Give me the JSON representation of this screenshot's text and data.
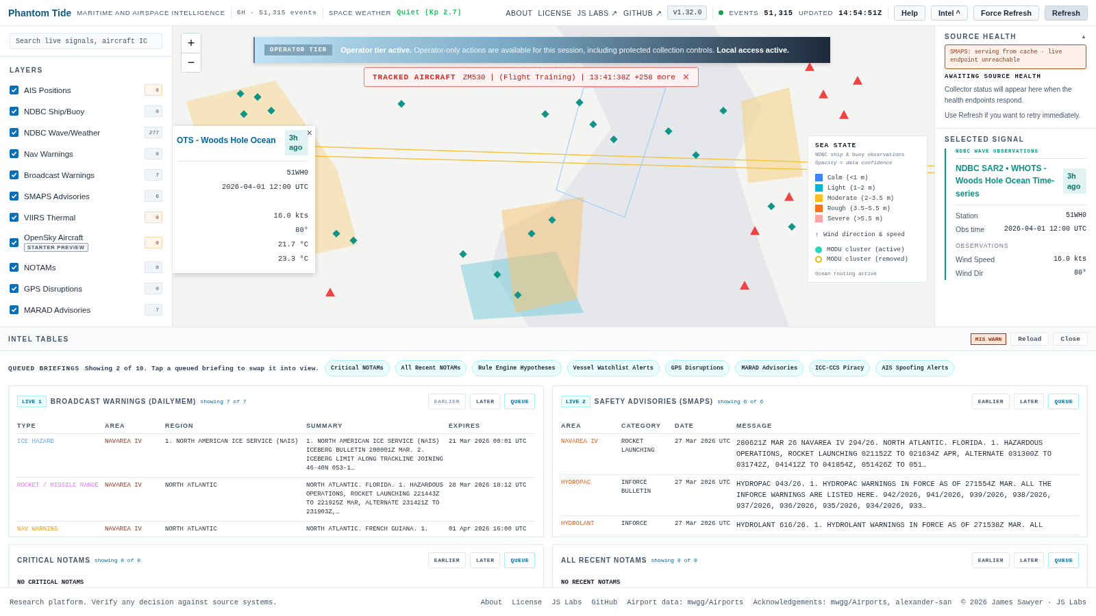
{
  "header": {
    "brand": "Phantom Tide",
    "tagline": "MARITIME AND AIRSPACE INTELLIGENCE",
    "window": "6H · 51,315 events",
    "space_weather_label": "SPACE WEATHER",
    "space_weather_value": "Quiet (Kp 2.7)",
    "nav": [
      "ABOUT",
      "LICENSE",
      "JS LABS ↗",
      "GITHUB ↗"
    ],
    "version": "v1.32.0",
    "online": true,
    "events_label": "EVENTS",
    "events_value": "51,315",
    "updated_label": "UPDATED",
    "updated_value": "14:54:51Z",
    "buttons": [
      {
        "label": "Help",
        "kind": "plain"
      },
      {
        "label": "Intel ^",
        "kind": "plain"
      },
      {
        "label": "Force Refresh",
        "kind": "plain"
      },
      {
        "label": "Refresh",
        "kind": "primary"
      }
    ]
  },
  "sidebar": {
    "search": {
      "placeholder": "Search live signals, aircraft IC"
    },
    "layers_title": "LAYERS",
    "layers": [
      {
        "label": "AIS Positions",
        "checked": true,
        "count": "0",
        "highlighted": true
      },
      {
        "label": "NDBC Ship/Buoy",
        "checked": true,
        "count": "0",
        "highlighted": false
      },
      {
        "label": "NDBC Wave/Weather",
        "checked": true,
        "count": "277",
        "highlighted": false
      },
      {
        "label": "Nav Warnings",
        "checked": true,
        "count": "0",
        "highlighted": false
      },
      {
        "label": "Broadcast Warnings",
        "checked": true,
        "count": "7",
        "highlighted": false
      },
      {
        "label": "SMAPS Advisories",
        "checked": true,
        "count": "6",
        "highlighted": false
      },
      {
        "label": "VIIRS Thermal",
        "checked": true,
        "count": "0",
        "highlighted": true
      },
      {
        "label": "OpenSky Aircraft",
        "badge": "STARTER PREVIEW",
        "checked": true,
        "count": "0",
        "highlighted": true
      },
      {
        "label": "NOTAMs",
        "checked": true,
        "count": "0",
        "highlighted": false
      },
      {
        "label": "GPS Disruptions",
        "checked": true,
        "count": "0",
        "highlighted": false
      },
      {
        "label": "MARAD Advisories",
        "checked": true,
        "count": "7",
        "highlighted": false
      }
    ]
  },
  "map": {
    "zoom_in": "+",
    "zoom_out": "−",
    "banner": {
      "tag": "OPERATOR TIER",
      "text": "**Operator tier active.** Operator-only actions are available for this session, including protected collection controls. **Local access active.**"
    },
    "alert": {
      "label": "TRACKED AIRCRAFT",
      "text": "ZM530 | (Flight Training) | 13:41:38Z +258 more",
      "close": "✕"
    },
    "popup": {
      "title": "OTS - Woods Hole Ocean",
      "age": "3h ago",
      "close": "×",
      "values": [
        "51WH0",
        "2026-04-01 12:00 UTC",
        "16.0 kts",
        "80°",
        "21.7 °C",
        "23.3 °C"
      ]
    },
    "legend": {
      "title": "SEA STATE",
      "subtitle": "NDBC ship & buoy observations",
      "note": "Opacity = data confidence",
      "items": [
        {
          "label": "Calm (<1 m)",
          "color": "#3b82f6"
        },
        {
          "label": "Light (1–2 m)",
          "color": "#06b6d4"
        },
        {
          "label": "Moderate (2–3.5 m)",
          "color": "#fbbf24"
        },
        {
          "label": "Rough (3.5–5.5 m)",
          "color": "#f97316"
        },
        {
          "label": "Severe (>5.5 m)",
          "color": "#fca5a5"
        }
      ],
      "extras": [
        {
          "kind": "arrow",
          "symbol": "↑",
          "label": "Wind direction & speed"
        },
        {
          "kind": "filled",
          "label": "MODU cluster (active)"
        },
        {
          "kind": "ring",
          "label": "MODU cluster (removed)"
        }
      ],
      "footer": "Ocean routing active"
    }
  },
  "right_panel": {
    "source_health": {
      "title": "SOURCE HEALTH",
      "toggle": "▲",
      "expanded": true,
      "warning": "SMAPS: serving from cache · live endpoint unreachable",
      "status_title": "AWAITING SOURCE HEALTH",
      "paragraphs": [
        "Collector status will appear here when the health endpoints respond.",
        "Use Refresh if you want to retry immediately."
      ]
    },
    "selected_signal": {
      "title": "SELECTED SIGNAL",
      "tag": "NDBC WAVE OBSERVATIONS",
      "name": "NDBC SAR2 • WHOTS - Woods Hole Ocean Time-series",
      "age": "3h ago",
      "rows": [
        {
          "label": "Station",
          "value": "51WH0"
        },
        {
          "label": "Obs time",
          "value": "2026-04-01 12:00 UTC"
        }
      ],
      "section": "OBSERVATIONS",
      "observations": [
        {
          "label": "Wind Speed",
          "value": "16.0 kts"
        },
        {
          "label": "Wind Dir",
          "value": "80°"
        }
      ]
    }
  },
  "intel": {
    "title": "INTEL TABLES",
    "badge": "MIS WARN",
    "buttons": [
      "Reload",
      "Close"
    ],
    "queue": {
      "label": "QUEUED BRIEFINGS",
      "text": "Showing 2 of 10. Tap a queued briefing to swap it into view.",
      "chips": [
        "Critical NOTAMs",
        "All Recent NOTAMs",
        "Rule Engine Hypotheses",
        "Vessel Watchlist Alerts",
        "GPS Disruptions",
        "MARAD Advisories",
        "ICC-CCS Piracy",
        "AIS Spoofing Alerts"
      ]
    },
    "panels": [
      {
        "live": "LIVE 1",
        "title": "BROADCAST WARNINGS (DAILYMEM)",
        "showing": "showing 7 of 7",
        "controls": [
          {
            "label": "EARLIER",
            "disabled": true,
            "kind": "nav"
          },
          {
            "label": "LATER",
            "disabled": false,
            "kind": "nav"
          },
          {
            "label": "QUEUE",
            "disabled": false,
            "kind": "queue"
          }
        ],
        "columns": [
          "TYPE",
          "AREA",
          "REGION",
          "SUMMARY",
          "EXPIRES"
        ],
        "kind": "warnings",
        "rows": [
          {
            "cells": [
              "ICE HAZARD",
              "NAVAREA IV",
              "1. NORTH AMERICAN ICE SERVICE (NAIS)",
              "1. NORTH AMERICAN ICE SERVICE (NAIS) ICEBERG BULLETIN 200001Z MAR. 2. ICEBERG LIMIT ALONG TRACKLINE JOINING 46-40N 053-1…",
              "21 Mar 2026 00:01 UTC"
            ],
            "kind": "ice"
          },
          {
            "cells": [
              "ROCKET / MISSILE RANGE",
              "NAVAREA IV",
              "NORTH ATLANTIC",
              "NORTH ATLANTIC. FLORIDA. 1. HAZARDOUS OPERATIONS, ROCKET LAUNCHING 221443Z TO 221925Z MAR, ALTERNATE 231421Z TO 231903Z,…",
              "28 Mar 2026 18:12 UTC"
            ],
            "kind": "range"
          },
          {
            "cells": [
              "NAV WARNING",
              "NAVAREA IV",
              "NORTH ATLANTIC",
              "NORTH ATLANTIC. FRENCH GUIANA. 1.",
              "01 Apr 2026 16:00 UTC"
            ],
            "kind": "nav"
          }
        ]
      },
      {
        "live": "LIVE 2",
        "title": "SAFETY ADVISORIES (SMAPS)",
        "showing": "showing 6 of 6",
        "controls": [
          {
            "label": "EARLIER",
            "disabled": false,
            "kind": "nav"
          },
          {
            "label": "LATER",
            "disabled": false,
            "kind": "nav"
          },
          {
            "label": "QUEUE",
            "disabled": false,
            "kind": "queue"
          }
        ],
        "columns": [
          "AREA",
          "CATEGORY",
          "DATE",
          "MESSAGE"
        ],
        "kind": "advisories",
        "rows": [
          {
            "cells": [
              "NAVAREA IV",
              "ROCKET LAUNCHING",
              "27 Mar 2026 UTC",
              "280621Z MAR 26 NAVAREA IV 294/26. NORTH ATLANTIC. FLORIDA. 1. HAZARDOUS OPERATIONS, ROCKET LAUNCHING 021152Z TO 021634Z APR, ALTERNATE 031300Z TO 031742Z, 041412Z TO 041854Z, 051426Z TO 051…"
            ]
          },
          {
            "cells": [
              "HYDROPAC",
              "INFORCE BULLETIN",
              "27 Mar 2026 UTC",
              "HYDROPAC 943/26. 1. HYDROPAC WARNINGS IN FORCE AS OF 271554Z MAR. ALL THE INFORCE WARNINGS ARE LISTED HERE. 942/2026, 941/2026, 939/2026, 938/2026, 937/2026, 936/2026, 935/2026, 934/2026, 933…"
            ]
          },
          {
            "cells": [
              "HYDROLANT",
              "INFORCE",
              "27 Mar 2026 UTC",
              "HYDROLANT 616/26. 1. HYDROLANT WARNINGS IN FORCE AS OF 271538Z MAR. ALL"
            ]
          }
        ]
      },
      {
        "title": "CRITICAL NOTAMS",
        "showing": "showing 0 of 0",
        "controls": [
          {
            "label": "EARLIER",
            "disabled": false,
            "kind": "nav"
          },
          {
            "label": "LATER",
            "disabled": false,
            "kind": "nav"
          },
          {
            "label": "QUEUE",
            "disabled": false,
            "kind": "queue"
          }
        ],
        "kind": "empty",
        "empty": "NO CRITICAL NOTAMS"
      },
      {
        "title": "ALL RECENT NOTAMS",
        "showing": "showing 0 of 0",
        "controls": [
          {
            "label": "EARLIER",
            "disabled": false,
            "kind": "nav"
          },
          {
            "label": "LATER",
            "disabled": false,
            "kind": "nav"
          },
          {
            "label": "QUEUE",
            "disabled": false,
            "kind": "queue"
          }
        ],
        "kind": "empty",
        "empty": "NO RECENT NOTAMS"
      }
    ]
  },
  "footer": {
    "text": "Research platform. Verify any decision against source systems.",
    "links": [
      "About",
      "License",
      "JS Labs",
      "GitHub",
      "Airport data: mwgg/Airports",
      "Acknowledgements: mwgg/Airports, alexander-san",
      "© 2026 James Sawyer · JS Labs"
    ]
  }
}
